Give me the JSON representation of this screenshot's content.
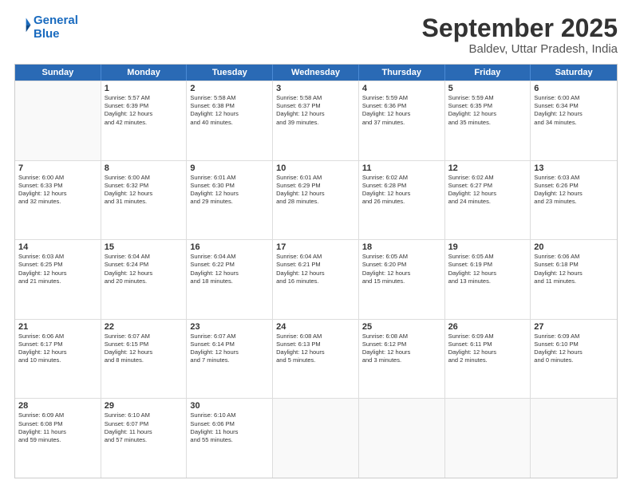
{
  "logo": {
    "line1": "General",
    "line2": "Blue"
  },
  "title": "September 2025",
  "subtitle": "Baldev, Uttar Pradesh, India",
  "days": [
    "Sunday",
    "Monday",
    "Tuesday",
    "Wednesday",
    "Thursday",
    "Friday",
    "Saturday"
  ],
  "rows": [
    [
      {
        "day": "",
        "detail": ""
      },
      {
        "day": "1",
        "detail": "Sunrise: 5:57 AM\nSunset: 6:39 PM\nDaylight: 12 hours\nand 42 minutes."
      },
      {
        "day": "2",
        "detail": "Sunrise: 5:58 AM\nSunset: 6:38 PM\nDaylight: 12 hours\nand 40 minutes."
      },
      {
        "day": "3",
        "detail": "Sunrise: 5:58 AM\nSunset: 6:37 PM\nDaylight: 12 hours\nand 39 minutes."
      },
      {
        "day": "4",
        "detail": "Sunrise: 5:59 AM\nSunset: 6:36 PM\nDaylight: 12 hours\nand 37 minutes."
      },
      {
        "day": "5",
        "detail": "Sunrise: 5:59 AM\nSunset: 6:35 PM\nDaylight: 12 hours\nand 35 minutes."
      },
      {
        "day": "6",
        "detail": "Sunrise: 6:00 AM\nSunset: 6:34 PM\nDaylight: 12 hours\nand 34 minutes."
      }
    ],
    [
      {
        "day": "7",
        "detail": "Sunrise: 6:00 AM\nSunset: 6:33 PM\nDaylight: 12 hours\nand 32 minutes."
      },
      {
        "day": "8",
        "detail": "Sunrise: 6:00 AM\nSunset: 6:32 PM\nDaylight: 12 hours\nand 31 minutes."
      },
      {
        "day": "9",
        "detail": "Sunrise: 6:01 AM\nSunset: 6:30 PM\nDaylight: 12 hours\nand 29 minutes."
      },
      {
        "day": "10",
        "detail": "Sunrise: 6:01 AM\nSunset: 6:29 PM\nDaylight: 12 hours\nand 28 minutes."
      },
      {
        "day": "11",
        "detail": "Sunrise: 6:02 AM\nSunset: 6:28 PM\nDaylight: 12 hours\nand 26 minutes."
      },
      {
        "day": "12",
        "detail": "Sunrise: 6:02 AM\nSunset: 6:27 PM\nDaylight: 12 hours\nand 24 minutes."
      },
      {
        "day": "13",
        "detail": "Sunrise: 6:03 AM\nSunset: 6:26 PM\nDaylight: 12 hours\nand 23 minutes."
      }
    ],
    [
      {
        "day": "14",
        "detail": "Sunrise: 6:03 AM\nSunset: 6:25 PM\nDaylight: 12 hours\nand 21 minutes."
      },
      {
        "day": "15",
        "detail": "Sunrise: 6:04 AM\nSunset: 6:24 PM\nDaylight: 12 hours\nand 20 minutes."
      },
      {
        "day": "16",
        "detail": "Sunrise: 6:04 AM\nSunset: 6:22 PM\nDaylight: 12 hours\nand 18 minutes."
      },
      {
        "day": "17",
        "detail": "Sunrise: 6:04 AM\nSunset: 6:21 PM\nDaylight: 12 hours\nand 16 minutes."
      },
      {
        "day": "18",
        "detail": "Sunrise: 6:05 AM\nSunset: 6:20 PM\nDaylight: 12 hours\nand 15 minutes."
      },
      {
        "day": "19",
        "detail": "Sunrise: 6:05 AM\nSunset: 6:19 PM\nDaylight: 12 hours\nand 13 minutes."
      },
      {
        "day": "20",
        "detail": "Sunrise: 6:06 AM\nSunset: 6:18 PM\nDaylight: 12 hours\nand 11 minutes."
      }
    ],
    [
      {
        "day": "21",
        "detail": "Sunrise: 6:06 AM\nSunset: 6:17 PM\nDaylight: 12 hours\nand 10 minutes."
      },
      {
        "day": "22",
        "detail": "Sunrise: 6:07 AM\nSunset: 6:15 PM\nDaylight: 12 hours\nand 8 minutes."
      },
      {
        "day": "23",
        "detail": "Sunrise: 6:07 AM\nSunset: 6:14 PM\nDaylight: 12 hours\nand 7 minutes."
      },
      {
        "day": "24",
        "detail": "Sunrise: 6:08 AM\nSunset: 6:13 PM\nDaylight: 12 hours\nand 5 minutes."
      },
      {
        "day": "25",
        "detail": "Sunrise: 6:08 AM\nSunset: 6:12 PM\nDaylight: 12 hours\nand 3 minutes."
      },
      {
        "day": "26",
        "detail": "Sunrise: 6:09 AM\nSunset: 6:11 PM\nDaylight: 12 hours\nand 2 minutes."
      },
      {
        "day": "27",
        "detail": "Sunrise: 6:09 AM\nSunset: 6:10 PM\nDaylight: 12 hours\nand 0 minutes."
      }
    ],
    [
      {
        "day": "28",
        "detail": "Sunrise: 6:09 AM\nSunset: 6:08 PM\nDaylight: 11 hours\nand 59 minutes."
      },
      {
        "day": "29",
        "detail": "Sunrise: 6:10 AM\nSunset: 6:07 PM\nDaylight: 11 hours\nand 57 minutes."
      },
      {
        "day": "30",
        "detail": "Sunrise: 6:10 AM\nSunset: 6:06 PM\nDaylight: 11 hours\nand 55 minutes."
      },
      {
        "day": "",
        "detail": ""
      },
      {
        "day": "",
        "detail": ""
      },
      {
        "day": "",
        "detail": ""
      },
      {
        "day": "",
        "detail": ""
      }
    ]
  ]
}
